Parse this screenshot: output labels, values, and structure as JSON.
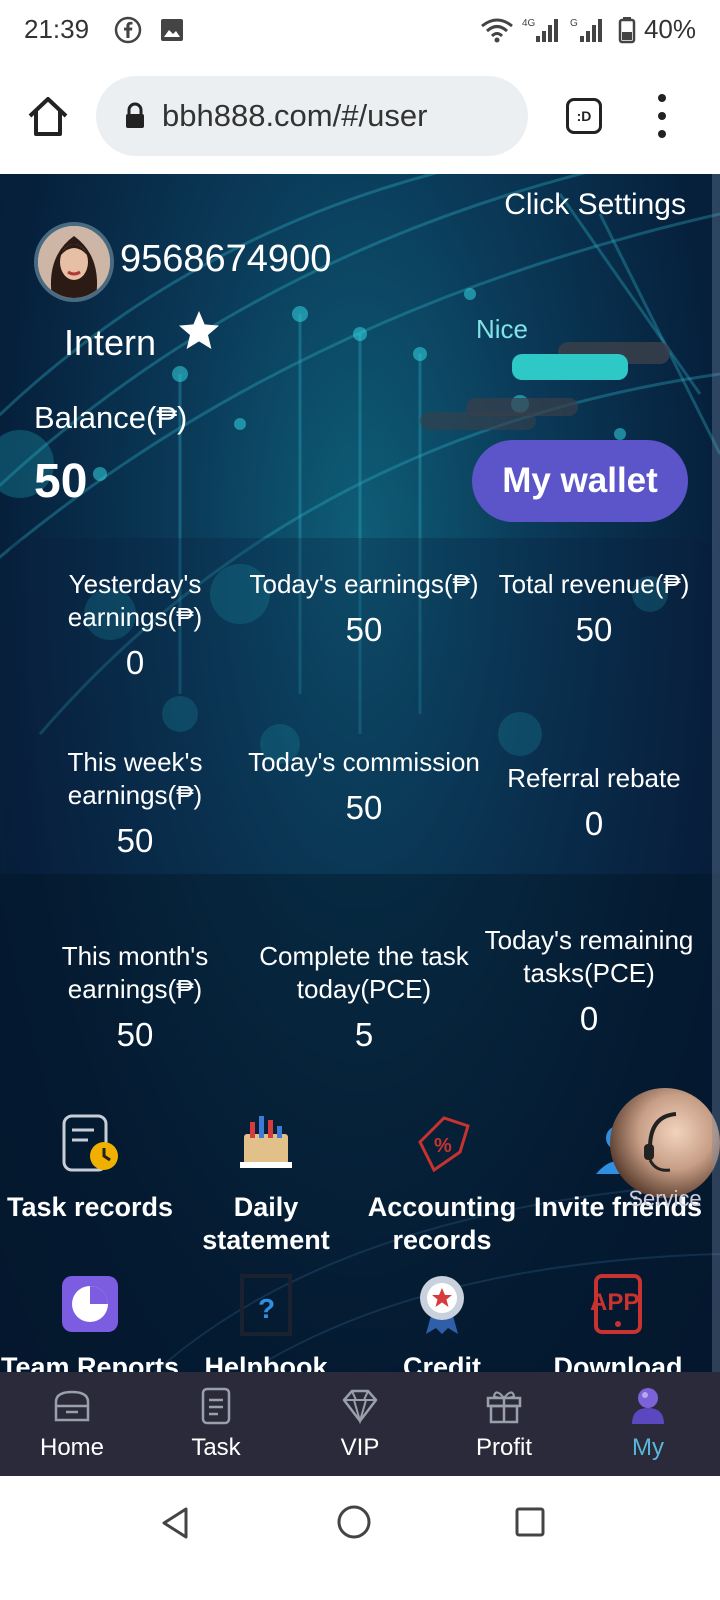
{
  "status_bar": {
    "time": "21:39",
    "battery": "40%",
    "icons": [
      "facebook-icon",
      "image-icon",
      "wifi-icon",
      "signal-4g-icon",
      "signal-g-icon",
      "battery-icon"
    ]
  },
  "browser": {
    "url": "bbh888.com/#/user",
    "tab_label": ":D"
  },
  "header": {
    "click_settings": "Click Settings",
    "username": "9568674900",
    "level": "Intern",
    "nice": "Nice"
  },
  "balance": {
    "label": "Balance(₱)",
    "value": "50",
    "wallet_button": "My wallet"
  },
  "stats": [
    {
      "label": "Yesterday's earnings(₱)",
      "value": "0"
    },
    {
      "label": "Today's earnings(₱)",
      "value": "50"
    },
    {
      "label": "Total revenue(₱)",
      "value": "50"
    },
    {
      "label": "This week's earnings(₱)",
      "value": "50"
    },
    {
      "label": "Today's commission",
      "value": "50"
    },
    {
      "label": "Referral rebate",
      "value": "0"
    },
    {
      "label": "This month's earnings(₱)",
      "value": "50"
    },
    {
      "label": "Complete the task today(PCE)",
      "value": "5"
    },
    {
      "label": "Today's remaining tasks(PCE)",
      "value": "0"
    }
  ],
  "grid_menu": [
    {
      "label": "Task records",
      "icon": "task-records-icon"
    },
    {
      "label": "Daily statement",
      "icon": "daily-statement-icon"
    },
    {
      "label": "Accounting records",
      "icon": "accounting-records-icon"
    },
    {
      "label": "Invite friends",
      "icon": "invite-friends-icon"
    },
    {
      "label": "Team Reports",
      "icon": "team-reports-icon"
    },
    {
      "label": "Helpbook",
      "icon": "helpbook-icon"
    },
    {
      "label": "Credit centres",
      "icon": "credit-centres-icon"
    },
    {
      "label": "Download",
      "icon": "download-app-icon"
    }
  ],
  "service": {
    "label": "Service"
  },
  "bottom_nav": [
    {
      "label": "Home",
      "icon": "home-icon"
    },
    {
      "label": "Task",
      "icon": "task-icon"
    },
    {
      "label": "VIP",
      "icon": "diamond-icon"
    },
    {
      "label": "Profit",
      "icon": "gift-icon"
    },
    {
      "label": "My",
      "icon": "user-icon",
      "active": true
    }
  ],
  "colors": {
    "accent": "#5b55c9",
    "active_nav": "#58b6d9",
    "nav_bg": "#2b2a3a"
  }
}
